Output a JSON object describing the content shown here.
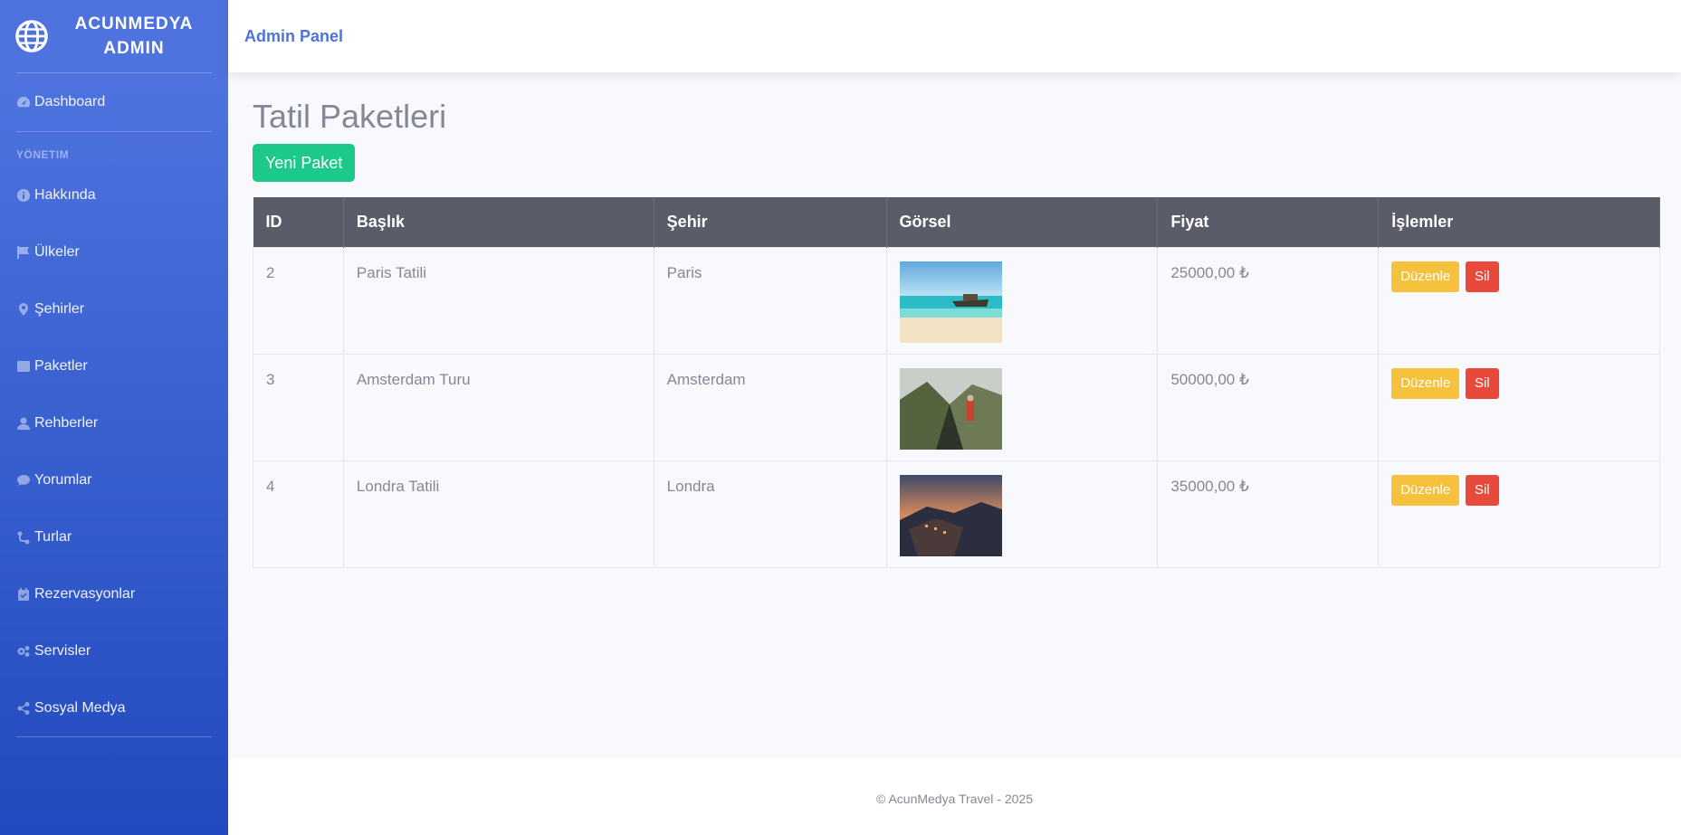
{
  "brand": {
    "line1": "ACUNMEDYA",
    "line2": "ADMIN"
  },
  "topbar": {
    "title": "Admin Panel"
  },
  "sidebar": {
    "dashboard": "Dashboard",
    "heading": "YÖNETIM",
    "items": [
      {
        "label": "Hakkında",
        "icon": "info-icon"
      },
      {
        "label": "Ülkeler",
        "icon": "flag-icon"
      },
      {
        "label": "Şehirler",
        "icon": "map-marker-icon"
      },
      {
        "label": "Paketler",
        "icon": "box-icon"
      },
      {
        "label": "Rehberler",
        "icon": "user-icon"
      },
      {
        "label": "Yorumlar",
        "icon": "comment-icon"
      },
      {
        "label": "Turlar",
        "icon": "route-icon"
      },
      {
        "label": "Rezervasyonlar",
        "icon": "calendar-check-icon"
      },
      {
        "label": "Servisler",
        "icon": "cogs-icon"
      },
      {
        "label": "Sosyal Medya",
        "icon": "share-icon"
      }
    ]
  },
  "main": {
    "title": "Tatil Paketleri",
    "new_button": "Yeni Paket",
    "columns": [
      "ID",
      "Başlık",
      "Şehir",
      "Görsel",
      "Fiyat",
      "İşlemler"
    ],
    "rows": [
      {
        "id": "2",
        "title": "Paris Tatili",
        "city": "Paris",
        "price": "25000,00 ₺",
        "image": "beach-boat-image"
      },
      {
        "id": "3",
        "title": "Amsterdam Turu",
        "city": "Amsterdam",
        "price": "50000,00 ₺",
        "image": "mountain-hiker-image"
      },
      {
        "id": "4",
        "title": "Londra Tatili",
        "city": "Londra",
        "price": "35000,00 ₺",
        "image": "coastal-town-sunset-image"
      }
    ],
    "edit_label": "Düzenle",
    "delete_label": "Sil"
  },
  "footer": {
    "text": "© AcunMedya Travel - 2025"
  },
  "colors": {
    "primary": "#4e73df",
    "success": "#1cc88a",
    "warning": "#f6c23e",
    "danger": "#e74a3b",
    "table_head": "#5a5c69"
  }
}
